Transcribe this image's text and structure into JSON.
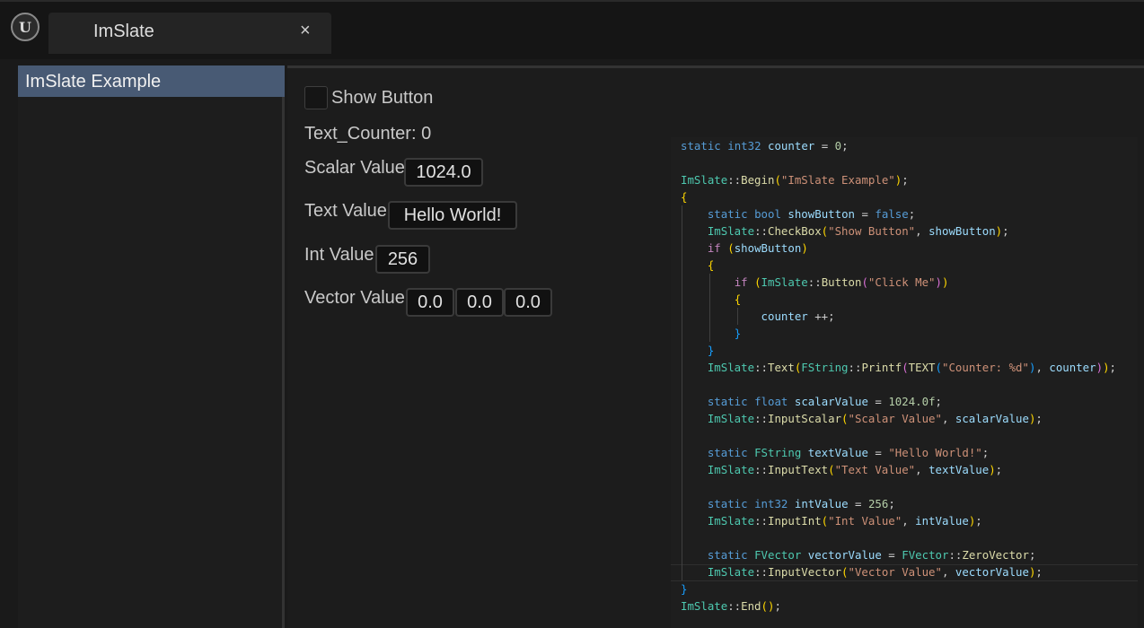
{
  "window": {
    "tab_title": "ImSlate",
    "close_glyph": "×",
    "logo_glyph": "U"
  },
  "sidebar": {
    "items": [
      {
        "label": "ImSlate Example",
        "selected": true
      }
    ]
  },
  "form": {
    "show_button": {
      "label": "Show Button",
      "checked": false
    },
    "counter_text": "Text_Counter: 0",
    "scalar": {
      "label": "Scalar Value",
      "value": "1024.0"
    },
    "text": {
      "label": "Text Value",
      "value": "Hello World!"
    },
    "int": {
      "label": "Int Value",
      "value": "256"
    },
    "vector": {
      "label": "Vector Value",
      "x": "0.0",
      "y": "0.0",
      "z": "0.0"
    }
  },
  "code": {
    "lines": [
      "static int32 counter = 0;",
      "",
      "ImSlate::Begin(\"ImSlate Example\");",
      "{",
      "    static bool showButton = false;",
      "    ImSlate::CheckBox(\"Show Button\", showButton);",
      "    if (showButton)",
      "    {",
      "        if (ImSlate::Button(\"Click Me\"))",
      "        {",
      "            counter ++;",
      "        }",
      "    }",
      "    ImSlate::Text(FString::Printf(TEXT(\"Counter: %d\"), counter));",
      "",
      "    static float scalarValue = 1024.0f;",
      "    ImSlate::InputScalar(\"Scalar Value\", scalarValue);",
      "",
      "    static FString textValue = \"Hello World!\";",
      "    ImSlate::InputText(\"Text Value\", textValue);",
      "",
      "    static int32 intValue = 256;",
      "    ImSlate::InputInt(\"Int Value\", intValue);",
      "",
      "    static FVector vectorValue = FVector::ZeroVector;",
      "    ImSlate::InputVector(\"Vector Value\", vectorValue);",
      "}",
      "ImSlate::End();"
    ]
  },
  "colors": {
    "selection": "#485a74",
    "keyword": "#569cd6",
    "string": "#ce9178",
    "function": "#dcdcaa",
    "class": "#4ec9b0",
    "variable": "#9cdcfe"
  }
}
